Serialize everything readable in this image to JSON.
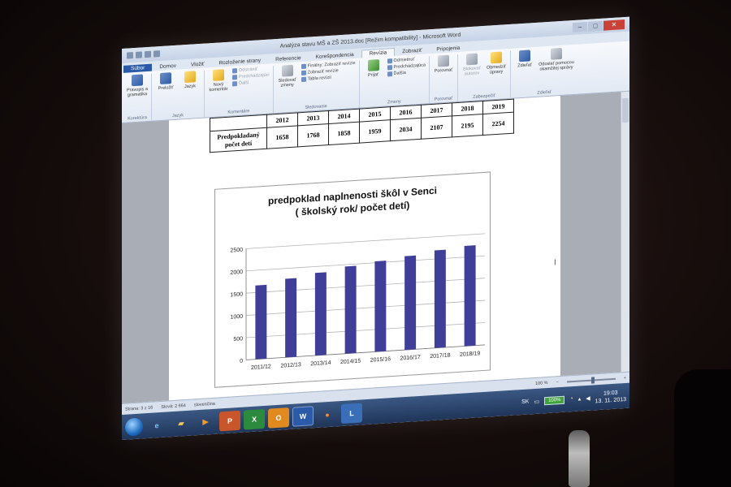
{
  "window": {
    "title": "Analýza stavu MŠ a ZŠ 2013.doc [Režim kompatibility] - Microsoft Word"
  },
  "ribbon": {
    "tabs": [
      {
        "label": "Súbor"
      },
      {
        "label": "Domov"
      },
      {
        "label": "Vložiť"
      },
      {
        "label": "Rozloženie strany"
      },
      {
        "label": "Referencie"
      },
      {
        "label": "Korešpondencia"
      },
      {
        "label": "Revízia"
      },
      {
        "label": "Zobraziť"
      },
      {
        "label": "Pripojenia"
      }
    ],
    "groups": {
      "korektura": {
        "label": "Korektúra",
        "spelling": "Pravopis a gramatika"
      },
      "jazyk": {
        "label": "Jazyk",
        "translate": "Preložiť",
        "language": "Jazyk"
      },
      "komentare": {
        "label": "Komentáre",
        "new_comment": "Nový komentár",
        "delete": "Odstrániť",
        "previous": "Predchádzajúci",
        "next": "Ďalší"
      },
      "sledovanie": {
        "label": "Sledovanie",
        "track": "Sledovať zmeny",
        "final_show": "Finálny: Zobraziť revízie",
        "show_revisions": "Zobraziť revízie",
        "pane": "Tabla revízií"
      },
      "zmeny": {
        "label": "Zmeny",
        "accept": "Prijať",
        "reject": "Odmietnuť",
        "previous": "Predchádzajúca",
        "next": "Ďalšia"
      },
      "porovnat": {
        "label": "Porovnať",
        "compare": "Porovnať"
      },
      "zabezpecit": {
        "label": "Zabezpečiť",
        "block_authors": "Blokovať autorov",
        "restrict": "Obmedziť úpravy"
      },
      "zdielat": {
        "label": "Zdieľať",
        "share": "Zdieľať",
        "send_im": "Odoslať pomocou okamžitej správy"
      }
    }
  },
  "document": {
    "table": {
      "years": [
        "2012",
        "2013",
        "2014",
        "2015",
        "2016",
        "2017",
        "2018",
        "2019"
      ],
      "row_label": "Predpokladaný počet detí",
      "values": [
        "1658",
        "1768",
        "1858",
        "1959",
        "2034",
        "2107",
        "2195",
        "2254"
      ]
    }
  },
  "chart_data": {
    "type": "bar",
    "title": "predpoklad naplnenosti škôl v Senci",
    "subtitle": "( školský rok/ počet detí)",
    "categories": [
      "2011/12",
      "2012/13",
      "2013/14",
      "2014/15",
      "2015/16",
      "2016/17",
      "2017/18",
      "2018/19"
    ],
    "values": [
      1658,
      1768,
      1858,
      1959,
      2034,
      2107,
      2195,
      2254
    ],
    "ylim": [
      0,
      2500
    ],
    "yticks": [
      "0",
      "500",
      "1000",
      "1500",
      "2000",
      "2500"
    ],
    "grid": true,
    "bar_color": "#3f3f9a"
  },
  "statusbar": {
    "page": "Strana: 3 z 16",
    "words": "Slová: 2 664",
    "language": "slovenčina",
    "zoom": "100 %"
  },
  "taskbar": {
    "input_lang": "SK",
    "battery": "100%",
    "time": "19:03",
    "date": "13. 11. 2013"
  }
}
